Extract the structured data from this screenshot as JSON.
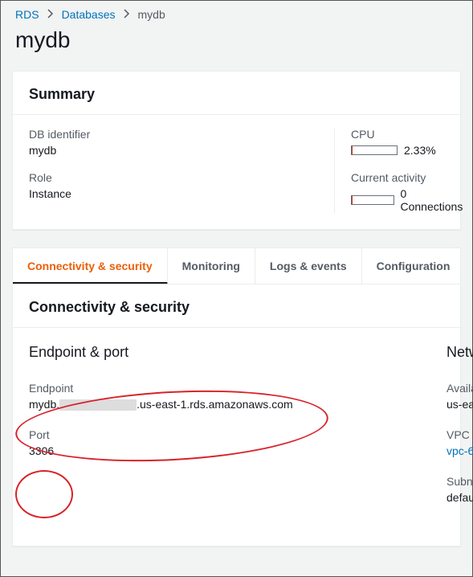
{
  "breadcrumbs": {
    "root": "RDS",
    "level1": "Databases",
    "current": "mydb"
  },
  "page_title": "mydb",
  "summary": {
    "heading": "Summary",
    "db_identifier_label": "DB identifier",
    "db_identifier_value": "mydb",
    "role_label": "Role",
    "role_value": "Instance",
    "cpu_label": "CPU",
    "cpu_value": "2.33%",
    "cpu_pct": 2.33,
    "activity_label": "Current activity",
    "activity_value": "0 Connections",
    "activity_pct": 0
  },
  "tabs": [
    {
      "label": "Connectivity & security",
      "active": true
    },
    {
      "label": "Monitoring",
      "active": false
    },
    {
      "label": "Logs & events",
      "active": false
    },
    {
      "label": "Configuration",
      "active": false
    }
  ],
  "cs": {
    "heading": "Connectivity & security",
    "section_title": "Endpoint & port",
    "endpoint_label": "Endpoint",
    "endpoint_prefix": "mydb.",
    "endpoint_suffix": ".us-east-1.rds.amazonaws.com",
    "port_label": "Port",
    "port_value": "3306",
    "net_title": "Netw",
    "avail_label": "Availa",
    "avail_value": "us-ea",
    "vpc_label": "VPC",
    "vpc_value": "vpc-6",
    "subnet_label": "Subne",
    "subnet_value": "defau"
  }
}
